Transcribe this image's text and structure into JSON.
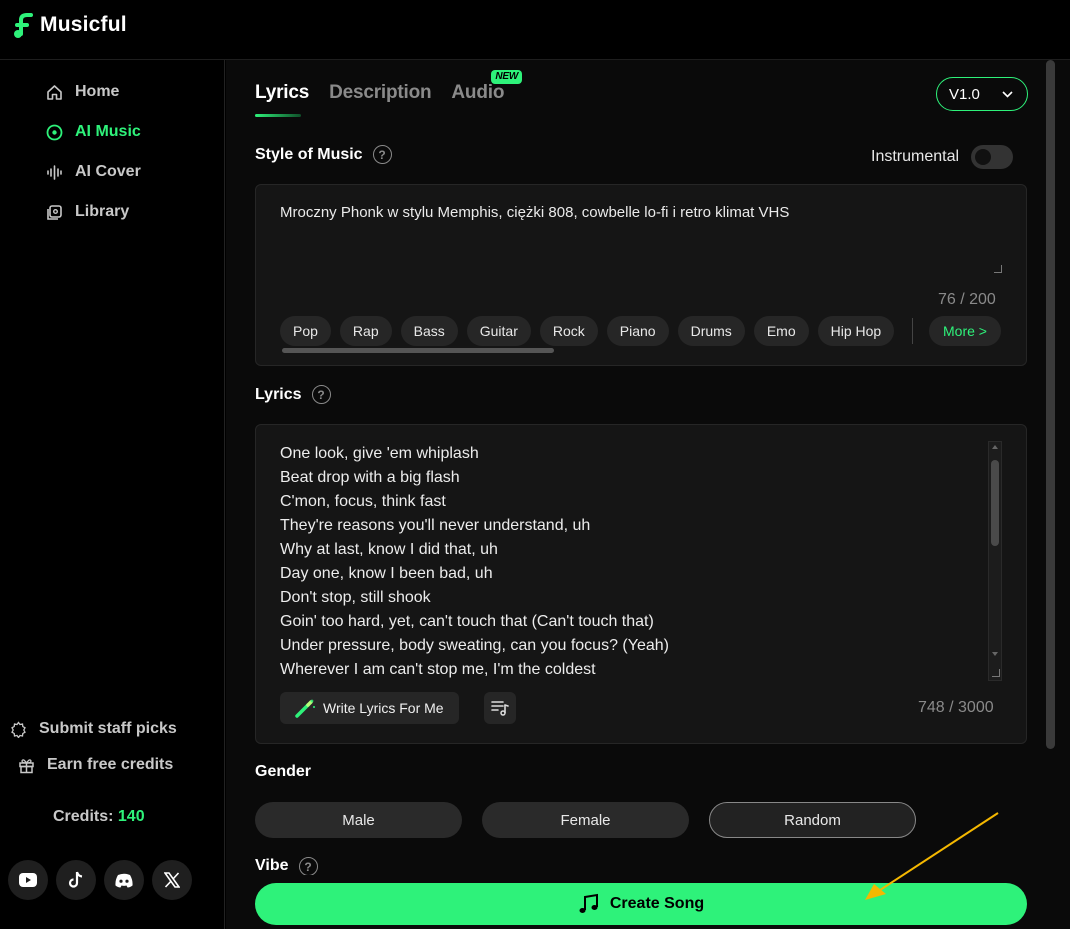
{
  "app": {
    "name": "Musicful"
  },
  "sidebar": {
    "items": [
      {
        "label": "Home",
        "icon": "home-icon",
        "active": false
      },
      {
        "label": "AI Music",
        "icon": "disc-icon",
        "active": true
      },
      {
        "label": "AI Cover",
        "icon": "waveform-icon",
        "active": false
      },
      {
        "label": "Library",
        "icon": "library-icon",
        "active": false
      }
    ],
    "bottom_links": [
      {
        "label": "Submit staff picks",
        "icon": "badge-icon"
      },
      {
        "label": "Earn free credits",
        "icon": "gift-icon"
      }
    ],
    "credits_label": "Credits:",
    "credits_value": "140",
    "socials": [
      "youtube-icon",
      "tiktok-icon",
      "discord-icon",
      "x-icon"
    ]
  },
  "main": {
    "tabs": [
      {
        "label": "Lyrics",
        "active": true
      },
      {
        "label": "Description",
        "active": false
      },
      {
        "label": "Audio",
        "active": false,
        "badge": "NEW"
      }
    ],
    "version": "V1.0",
    "style": {
      "label": "Style of Music",
      "instrumental_label": "Instrumental",
      "instrumental_on": false,
      "value": "Mroczny Phonk w stylu Memphis, ciężki 808, cowbelle lo-fi i retro klimat VHS",
      "counter": "76 / 200",
      "chips": [
        "Pop",
        "Rap",
        "Bass",
        "Guitar",
        "Rock",
        "Piano",
        "Drums",
        "Emo",
        "Hip Hop"
      ],
      "more_label": "More >"
    },
    "lyrics": {
      "label": "Lyrics",
      "lines": [
        "One look, give 'em whiplash",
        "Beat drop with a big flash",
        "C'mon, focus, think fast",
        "They're reasons you'll never understand, uh",
        "Why at last, know I did that, uh",
        "Day one, know I been bad, uh",
        "Don't stop, still shook",
        "Goin' too hard, yet, can't touch that (Can't touch that)",
        "Under pressure, body sweating, can you focus? (Yeah)",
        "Wherever I am can't stop me, I'm the coldest"
      ],
      "write_button": "Write Lyrics For Me",
      "counter": "748 / 3000"
    },
    "gender": {
      "label": "Gender",
      "options": [
        "Male",
        "Female",
        "Random"
      ],
      "selected": "Random"
    },
    "vibe_label": "Vibe",
    "create_button": "Create Song"
  },
  "colors": {
    "accent": "#2ef27a",
    "background": "#0a0a0a",
    "panel": "#151515",
    "annotation_arrow": "#f5b800"
  }
}
